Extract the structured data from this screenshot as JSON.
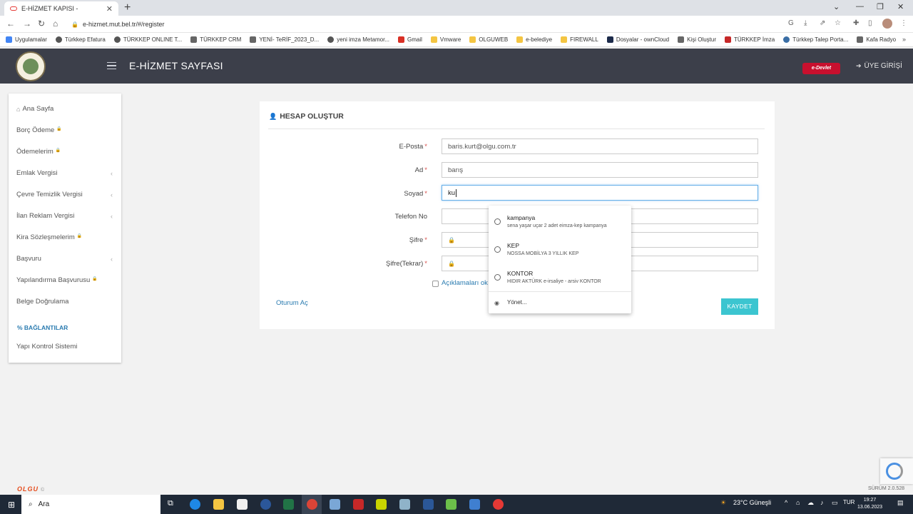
{
  "browser": {
    "tab_title": "E-HİZMET KAPISI -",
    "url": "e-hizmet.mut.bel.tr/#/register",
    "bookmarks": [
      "Uygulamalar",
      "Türkkep Efatura",
      "TÜRKKEP ONLINE T...",
      "TÜRKKEP CRM",
      "YENİ- TeRİF_2023_D...",
      "yeni imza Metamor...",
      "Gmail",
      "Vmware",
      "OLGUWEB",
      "e-belediye",
      "FIREWALL",
      "Dosyalar - ownCloud",
      "Kişi Oluştur",
      "TÜRKKEP İmza",
      "Türkkep Talep Porta...",
      "Kafa Radyo"
    ]
  },
  "header": {
    "title": "E-HİZMET SAYFASI",
    "edevlet": "e-Devlet",
    "login": "ÜYE GİRİŞİ"
  },
  "sidebar": {
    "items": [
      {
        "label": "Ana Sayfa"
      },
      {
        "label": "Borç Ödeme"
      },
      {
        "label": "Ödemelerim"
      },
      {
        "label": "Emlak Vergisi"
      },
      {
        "label": "Çevre Temizlik Vergisi"
      },
      {
        "label": "İlan Reklam Vergisi"
      },
      {
        "label": "Kira Sözleşmelerim"
      },
      {
        "label": "Başvuru"
      },
      {
        "label": "Yapılandırma Başvurusu"
      },
      {
        "label": "Belge Doğrulama"
      }
    ],
    "section": "BAĞLANTILAR",
    "links": [
      "Yapı Kontrol Sistemi"
    ]
  },
  "form": {
    "title": "HESAP OLUŞTUR",
    "fields": {
      "email": {
        "label": "E-Posta",
        "value": "baris.kurt@olgu.com.tr"
      },
      "name": {
        "label": "Ad",
        "value": "barış"
      },
      "surname": {
        "label": "Soyad",
        "value": "ku"
      },
      "phone": {
        "label": "Telefon No",
        "value": ""
      },
      "password": {
        "label": "Şifre",
        "value": ""
      },
      "password2": {
        "label": "Şifre(Tekrar)",
        "value": ""
      }
    },
    "terms_text": "Açıklamaları ok",
    "login_link": "Oturum Aç",
    "save_button": "KAYDET"
  },
  "autofill": {
    "items": [
      {
        "title": "kampanya",
        "subtitle": "sena yaşar uçar 2 adet eimza-kep kampanya"
      },
      {
        "title": "KEP",
        "subtitle": "NOSSA MOBİLYA 3 YILLIK KEP"
      },
      {
        "title": "KONTOR",
        "subtitle": "HIDIR AKTÜRK e-irsaliye - arsiv KONTOR"
      }
    ],
    "manage": "Yönet..."
  },
  "footer": {
    "brand": "OLGU",
    "copyright": "©",
    "version": "SÜRÜM 2.0.528"
  },
  "taskbar": {
    "search": "Ara",
    "weather": "23°C Güneşli",
    "lang": "TUR",
    "time": "19:27",
    "date": "13.06.2023"
  }
}
